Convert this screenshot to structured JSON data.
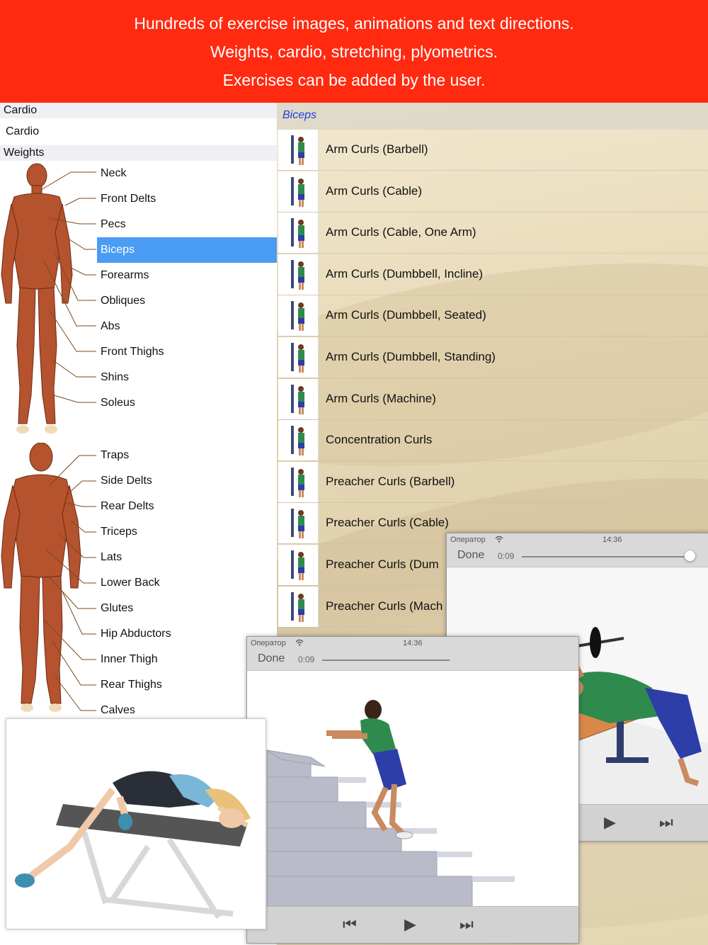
{
  "banner": {
    "line1": "Hundreds of exercise images, animations and text directions.",
    "line2": "Weights, cardio, stretching, plyometrics.",
    "line3": "Exercises can be added by the user.",
    "background": "#ff2a10"
  },
  "left": {
    "cardio_header": "Cardio",
    "cardio_item": "Cardio",
    "weights_header": "Weights",
    "front_muscles": [
      "Neck",
      "Front Delts",
      "Pecs",
      "Biceps",
      "Forearms",
      "Obliques",
      "Abs",
      "Front Thighs",
      "Shins",
      "Soleus"
    ],
    "back_muscles": [
      "Traps",
      "Side Delts",
      "Rear Delts",
      "Triceps",
      "Lats",
      "Lower Back",
      "Glutes",
      "Hip Abductors",
      "Inner Thigh",
      "Rear Thighs",
      "Calves"
    ],
    "selected": "Biceps",
    "selected_color": "#4a9cf5"
  },
  "list": {
    "header": "Biceps",
    "header_color": "#1d3fd6",
    "items": [
      "Arm Curls (Barbell)",
      "Arm Curls (Cable)",
      "Arm Curls (Cable, One Arm)",
      "Arm Curls (Dumbbell, Incline)",
      "Arm Curls (Dumbbell, Seated)",
      "Arm Curls (Dumbbell, Standing)",
      "Arm Curls (Machine)",
      "Concentration Curls",
      "Preacher Curls (Barbell)",
      "Preacher Curls (Cable)",
      "Preacher Curls (Dum",
      "Preacher Curls (Mach"
    ]
  },
  "player_right": {
    "carrier": "Оператор",
    "time": "14:36",
    "done": "Done",
    "elapsed": "0:09",
    "icons": [
      "wifi-icon",
      "rewind-icon",
      "play-icon",
      "fast-forward-icon"
    ]
  },
  "player_left": {
    "carrier": "Оператор",
    "time": "14:36",
    "done": "Done",
    "elapsed": "0:09",
    "icons": [
      "wifi-icon",
      "rewind-icon",
      "play-icon",
      "fast-forward-icon"
    ]
  },
  "controls": {
    "rewind": "⏮",
    "play": "▶",
    "forward": "⏭",
    "wifi": "≋"
  }
}
